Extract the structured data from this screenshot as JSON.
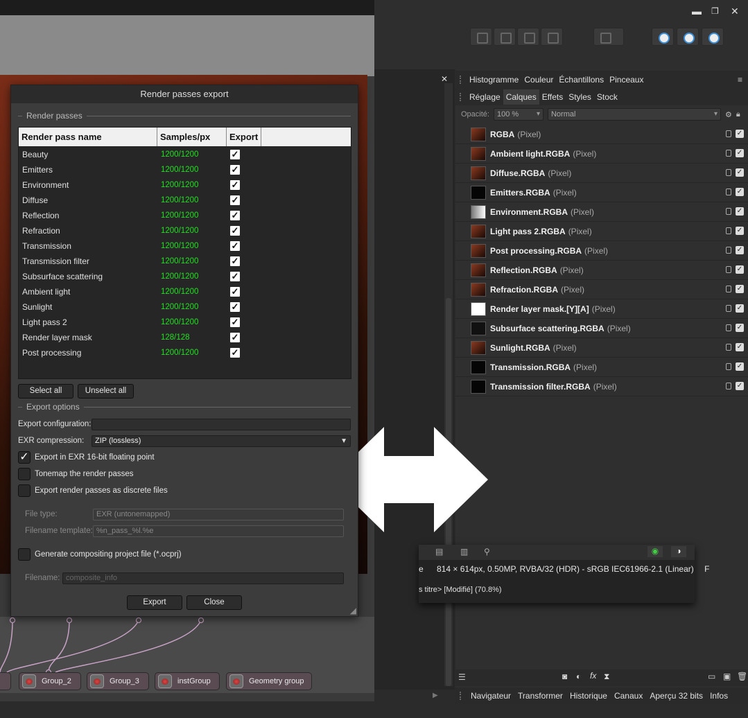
{
  "window_controls": {
    "minimize": "▬",
    "restore": "❐",
    "close": "✕"
  },
  "panel_tabs_top": [
    "Histogramme",
    "Couleur",
    "Échantillons",
    "Pinceaux"
  ],
  "panel_tabs_second": [
    "Réglage",
    "Calques",
    "Effets",
    "Styles",
    "Stock"
  ],
  "panel_tabs_second_active": "Calques",
  "opacity": {
    "label": "Opacité:",
    "value": "100 %",
    "blend": "Normal"
  },
  "layers": [
    {
      "name": "RGBA",
      "type": "(Pixel)"
    },
    {
      "name": "Ambient light.RGBA",
      "type": "(Pixel)"
    },
    {
      "name": "Diffuse.RGBA",
      "type": "(Pixel)"
    },
    {
      "name": "Emitters.RGBA",
      "type": "(Pixel)"
    },
    {
      "name": "Environment.RGBA",
      "type": "(Pixel)"
    },
    {
      "name": "Light pass 2.RGBA",
      "type": "(Pixel)"
    },
    {
      "name": "Post processing.RGBA",
      "type": "(Pixel)"
    },
    {
      "name": "Reflection.RGBA",
      "type": "(Pixel)"
    },
    {
      "name": "Refraction.RGBA",
      "type": "(Pixel)"
    },
    {
      "name": "Render layer mask.[Y][A]",
      "type": "(Pixel)"
    },
    {
      "name": "Subsurface scattering.RGBA",
      "type": "(Pixel)"
    },
    {
      "name": "Sunlight.RGBA",
      "type": "(Pixel)"
    },
    {
      "name": "Transmission.RGBA",
      "type": "(Pixel)"
    },
    {
      "name": "Transmission filter.RGBA",
      "type": "(Pixel)"
    }
  ],
  "bottom_tabs": [
    "Navigateur",
    "Transformer",
    "Historique",
    "Canaux",
    "Aperçu 32 bits",
    "Infos"
  ],
  "doc_info": {
    "prefix": "e",
    "details": "814 × 614px, 0.50MP, RVBA/32 (HDR) - sRGB IEC61966-2.1 (Linear)",
    "suffix": "F",
    "title": "s titre> [Modifié] (70.8%)"
  },
  "nodes": [
    "",
    "Group_2",
    "Group_3",
    "instGroup",
    "Geometry group"
  ],
  "dialog": {
    "title": "Render passes export",
    "section_render_passes": "Render passes",
    "columns": [
      "Render pass name",
      "Samples/px",
      "Export"
    ],
    "passes": [
      {
        "name": "Beauty",
        "samples": "1200/1200",
        "export": "✓"
      },
      {
        "name": "Emitters",
        "samples": "1200/1200",
        "export": "✓"
      },
      {
        "name": "Environment",
        "samples": "1200/1200",
        "export": "✓"
      },
      {
        "name": "Diffuse",
        "samples": "1200/1200",
        "export": "✓"
      },
      {
        "name": "Reflection",
        "samples": "1200/1200",
        "export": "✓"
      },
      {
        "name": "Refraction",
        "samples": "1200/1200",
        "export": "✓"
      },
      {
        "name": "Transmission",
        "samples": "1200/1200",
        "export": "✓"
      },
      {
        "name": "Transmission filter",
        "samples": "1200/1200",
        "export": "✓"
      },
      {
        "name": "Subsurface scattering",
        "samples": "1200/1200",
        "export": "✓"
      },
      {
        "name": "Ambient light",
        "samples": "1200/1200",
        "export": "✓"
      },
      {
        "name": "Sunlight",
        "samples": "1200/1200",
        "export": "✓"
      },
      {
        "name": "Light pass 2",
        "samples": "1200/1200",
        "export": "✓"
      },
      {
        "name": "Render layer mask",
        "samples": "128/128",
        "export": "✓"
      },
      {
        "name": "Post processing",
        "samples": "1200/1200",
        "export": "✓"
      }
    ],
    "select_all": "Select all",
    "unselect_all": "Unselect all",
    "section_export_options": "Export options",
    "export_configuration_label": "Export configuration:",
    "export_configuration_value": "",
    "exr_compression_label": "EXR compression:",
    "exr_compression_value": "ZIP (lossless)",
    "opt_16bit": {
      "label": "Export in EXR 16-bit floating point",
      "checked": "✓"
    },
    "opt_tonemap": {
      "label": "Tonemap the render passes",
      "checked": ""
    },
    "opt_discrete": {
      "label": "Export render passes as discrete files",
      "checked": ""
    },
    "file_type_label": "File type:",
    "file_type_value": "EXR (untonemapped)",
    "filename_template_label": "Filename template:",
    "filename_template_value": "%n_pass_%l.%e",
    "opt_compositing": {
      "label": "Generate compositing project file (*.ocprj)",
      "checked": ""
    },
    "filename_label": "Filename:",
    "filename_value": "composite_info",
    "export_button": "Export",
    "close_button": "Close"
  }
}
